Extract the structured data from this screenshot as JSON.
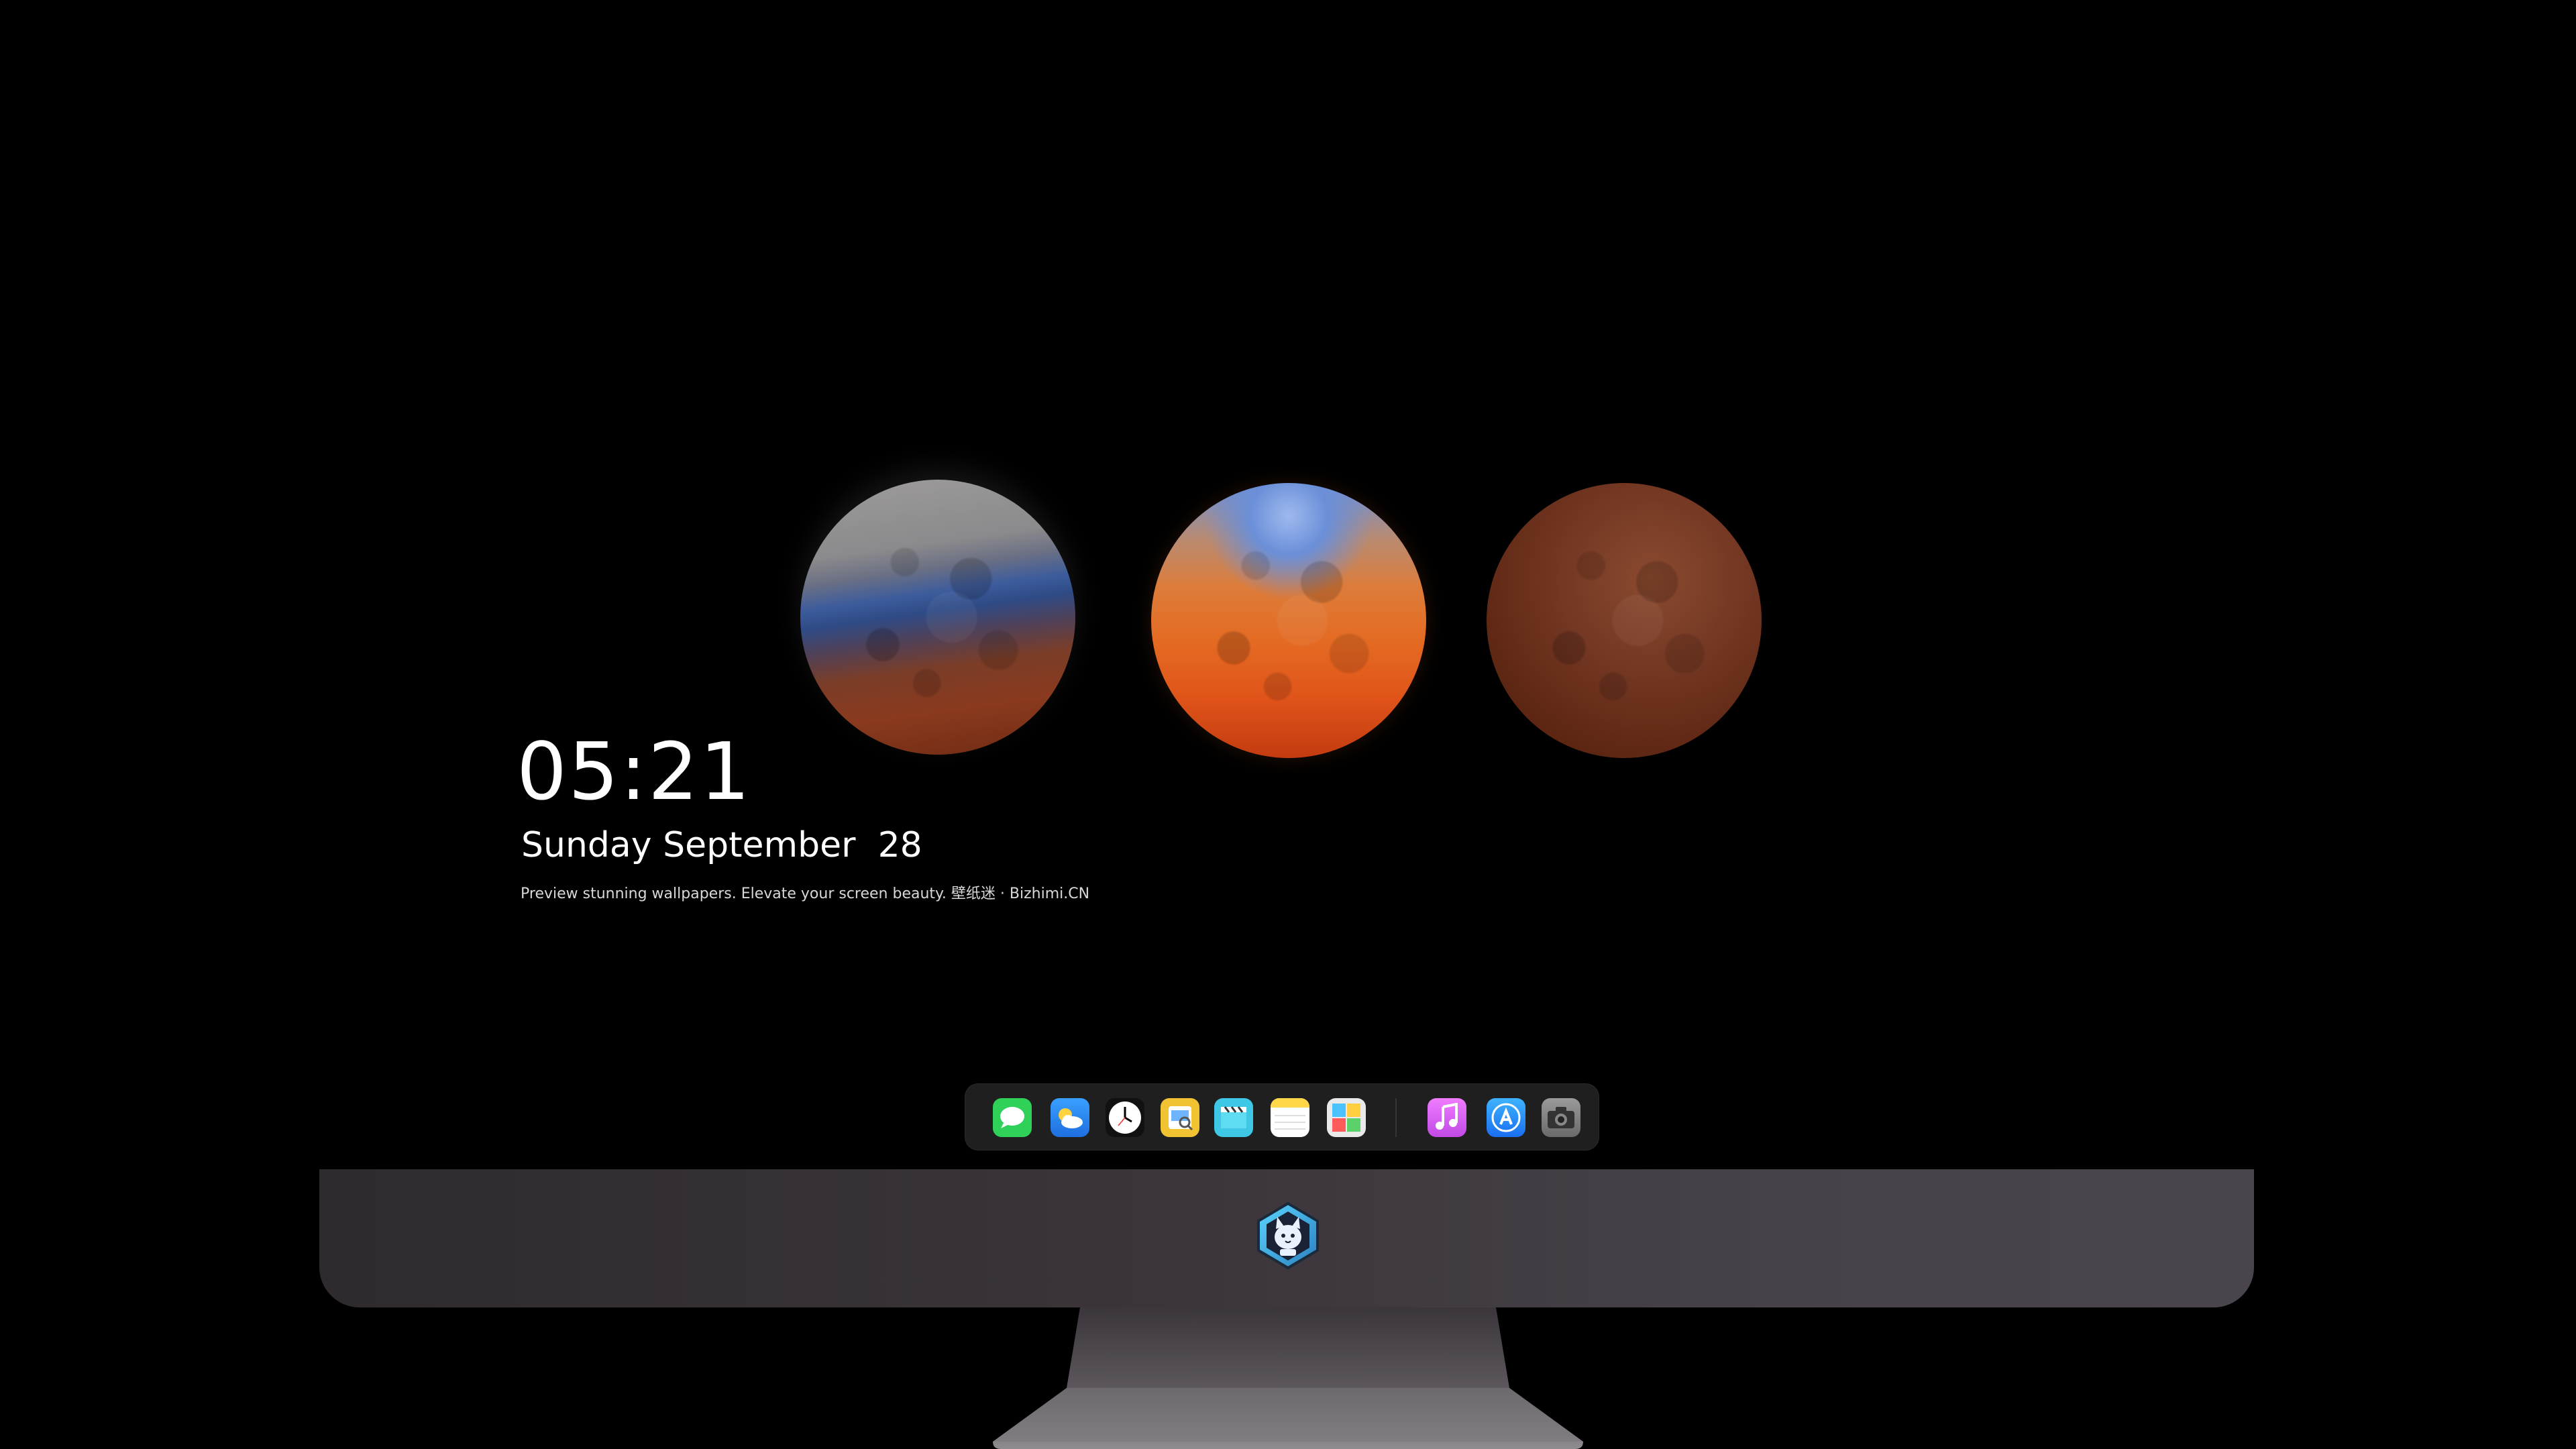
{
  "lock_screen": {
    "time": "05:21",
    "weekday": "Sunday",
    "month": "September",
    "day": "28",
    "tagline": "Preview stunning wallpapers. Elevate your screen beauty. 壁纸迷 · Bizhimi.CN"
  },
  "dock": {
    "items": [
      {
        "name": "messages-icon",
        "color": "#2fd158"
      },
      {
        "name": "weather-icon",
        "color": "#2f8ff0"
      },
      {
        "name": "clock-icon",
        "color": "#ffffff"
      },
      {
        "name": "preview-icon",
        "color": "#f1c232"
      },
      {
        "name": "clips-icon",
        "color": "#3ec8e6"
      },
      {
        "name": "notes-icon",
        "color": "#ffd84a"
      },
      {
        "name": "photo-booth-icon",
        "color": "#e9e9e9"
      },
      {
        "name": "itunes-icon",
        "color": "#d85cf0"
      },
      {
        "name": "app-store-icon",
        "color": "#1a8cff"
      },
      {
        "name": "camera-icon",
        "color": "#8c8c8c"
      }
    ]
  },
  "colors": {
    "background": "#000000",
    "dock_background": "#1f1f20",
    "monitor_chin": "#3a3438"
  }
}
